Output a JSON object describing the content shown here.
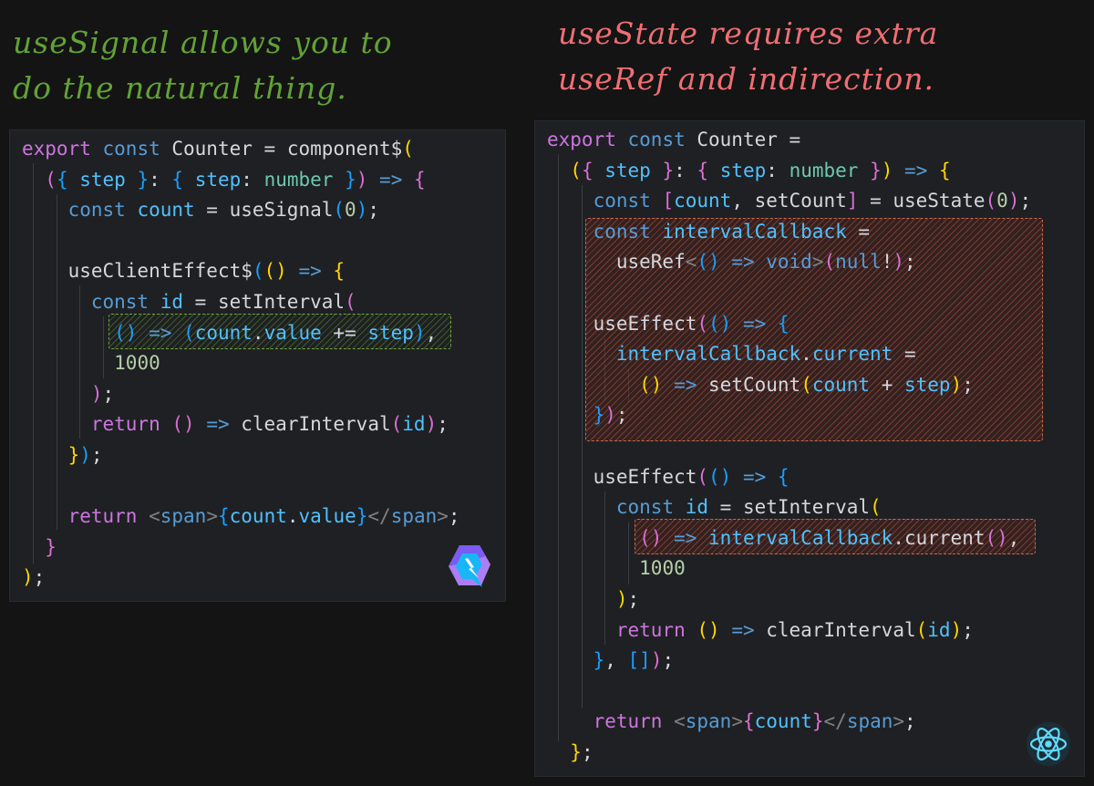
{
  "captions": {
    "left": "useSignal allows you to do the natural thing.",
    "right": "useState requires extra useRef and indirection."
  },
  "colors": {
    "keyword": "#cd75e0",
    "keyword_blue": "#569cd6",
    "identifier": "#d6d6dd",
    "variable": "#4fc1ff",
    "type": "#6dc8b0",
    "number": "#b5cea8",
    "operator": "#56b6c2",
    "bracket_yellow": "#ffd700",
    "bracket_pink": "#da70d6",
    "bracket_blue": "#179fff",
    "tag": "#808080",
    "caption_left": "#62a334",
    "caption_right": "#ef6e73",
    "background": "#141414",
    "panel": "#1f2023"
  },
  "logos": {
    "left": "qwik-logo",
    "right": "react-logo"
  },
  "left_panel": {
    "lines": [
      [
        {
          "t": "export ",
          "c": "keyword"
        },
        {
          "t": "const ",
          "c": "keyword_blue"
        },
        {
          "t": "Counter",
          "c": "identifier"
        },
        {
          "t": " = ",
          "c": "identifier"
        },
        {
          "t": "component$",
          "c": "identifier"
        },
        {
          "t": "(",
          "c": "bracket_yellow"
        }
      ],
      [
        {
          "t": "  ",
          "c": "identifier"
        },
        {
          "t": "(",
          "c": "bracket_pink"
        },
        {
          "t": "{",
          "c": "bracket_blue"
        },
        {
          "t": " step ",
          "c": "variable"
        },
        {
          "t": "}",
          "c": "bracket_blue"
        },
        {
          "t": ": ",
          "c": "identifier"
        },
        {
          "t": "{",
          "c": "bracket_blue"
        },
        {
          "t": " step",
          "c": "variable"
        },
        {
          "t": ": ",
          "c": "identifier"
        },
        {
          "t": "number",
          "c": "type"
        },
        {
          "t": " }",
          "c": "bracket_blue"
        },
        {
          "t": ")",
          "c": "bracket_pink"
        },
        {
          "t": " => ",
          "c": "keyword_blue"
        },
        {
          "t": "{",
          "c": "bracket_pink"
        }
      ],
      [
        {
          "t": "    ",
          "c": "identifier"
        },
        {
          "t": "const ",
          "c": "keyword_blue"
        },
        {
          "t": "count",
          "c": "variable"
        },
        {
          "t": " = ",
          "c": "identifier"
        },
        {
          "t": "useSignal",
          "c": "identifier"
        },
        {
          "t": "(",
          "c": "bracket_blue"
        },
        {
          "t": "0",
          "c": "number"
        },
        {
          "t": ")",
          "c": "bracket_blue"
        },
        {
          "t": ";",
          "c": "identifier"
        }
      ],
      [],
      [
        {
          "t": "    ",
          "c": "identifier"
        },
        {
          "t": "useClientEffect$",
          "c": "identifier"
        },
        {
          "t": "(",
          "c": "bracket_blue"
        },
        {
          "t": "()",
          "c": "bracket_yellow"
        },
        {
          "t": " => ",
          "c": "keyword_blue"
        },
        {
          "t": "{",
          "c": "bracket_yellow"
        }
      ],
      [
        {
          "t": "      ",
          "c": "identifier"
        },
        {
          "t": "const ",
          "c": "keyword_blue"
        },
        {
          "t": "id",
          "c": "variable"
        },
        {
          "t": " = ",
          "c": "identifier"
        },
        {
          "t": "setInterval",
          "c": "identifier"
        },
        {
          "t": "(",
          "c": "bracket_pink"
        }
      ],
      [
        {
          "t": "        ",
          "c": "identifier"
        },
        {
          "t": "()",
          "c": "bracket_blue"
        },
        {
          "t": " => ",
          "c": "keyword_blue"
        },
        {
          "t": "(",
          "c": "bracket_blue"
        },
        {
          "t": "count",
          "c": "variable"
        },
        {
          "t": ".",
          "c": "identifier"
        },
        {
          "t": "value",
          "c": "variable"
        },
        {
          "t": " += ",
          "c": "identifier"
        },
        {
          "t": "step",
          "c": "variable"
        },
        {
          "t": ")",
          "c": "bracket_blue"
        },
        {
          "t": ",",
          "c": "identifier"
        }
      ],
      [
        {
          "t": "        ",
          "c": "identifier"
        },
        {
          "t": "1000",
          "c": "number"
        }
      ],
      [
        {
          "t": "      ",
          "c": "identifier"
        },
        {
          "t": ")",
          "c": "bracket_pink"
        },
        {
          "t": ";",
          "c": "identifier"
        }
      ],
      [
        {
          "t": "      ",
          "c": "identifier"
        },
        {
          "t": "return ",
          "c": "keyword"
        },
        {
          "t": "()",
          "c": "bracket_pink"
        },
        {
          "t": " => ",
          "c": "keyword_blue"
        },
        {
          "t": "clearInterval",
          "c": "identifier"
        },
        {
          "t": "(",
          "c": "bracket_pink"
        },
        {
          "t": "id",
          "c": "variable"
        },
        {
          "t": ")",
          "c": "bracket_pink"
        },
        {
          "t": ";",
          "c": "identifier"
        }
      ],
      [
        {
          "t": "    ",
          "c": "identifier"
        },
        {
          "t": "}",
          "c": "bracket_yellow"
        },
        {
          "t": ")",
          "c": "bracket_blue"
        },
        {
          "t": ";",
          "c": "identifier"
        }
      ],
      [],
      [
        {
          "t": "    ",
          "c": "identifier"
        },
        {
          "t": "return ",
          "c": "keyword"
        },
        {
          "t": "<",
          "c": "tag"
        },
        {
          "t": "span",
          "c": "keyword_blue"
        },
        {
          "t": ">",
          "c": "tag"
        },
        {
          "t": "{",
          "c": "bracket_blue"
        },
        {
          "t": "count",
          "c": "variable"
        },
        {
          "t": ".",
          "c": "identifier"
        },
        {
          "t": "value",
          "c": "variable"
        },
        {
          "t": "}",
          "c": "bracket_blue"
        },
        {
          "t": "</",
          "c": "tag"
        },
        {
          "t": "span",
          "c": "keyword_blue"
        },
        {
          "t": ">",
          "c": "tag"
        },
        {
          "t": ";",
          "c": "identifier"
        }
      ],
      [
        {
          "t": "  ",
          "c": "identifier"
        },
        {
          "t": "}",
          "c": "bracket_pink"
        }
      ],
      [
        {
          "t": ")",
          "c": "bracket_yellow"
        },
        {
          "t": ";",
          "c": "identifier"
        }
      ]
    ]
  },
  "right_panel": {
    "lines": [
      [
        {
          "t": "export ",
          "c": "keyword"
        },
        {
          "t": "const ",
          "c": "keyword_blue"
        },
        {
          "t": "Counter",
          "c": "identifier"
        },
        {
          "t": " =",
          "c": "identifier"
        }
      ],
      [
        {
          "t": "  ",
          "c": "identifier"
        },
        {
          "t": "(",
          "c": "bracket_yellow"
        },
        {
          "t": "{",
          "c": "bracket_pink"
        },
        {
          "t": " step ",
          "c": "variable"
        },
        {
          "t": "}",
          "c": "bracket_pink"
        },
        {
          "t": ": ",
          "c": "identifier"
        },
        {
          "t": "{",
          "c": "bracket_pink"
        },
        {
          "t": " step",
          "c": "variable"
        },
        {
          "t": ": ",
          "c": "identifier"
        },
        {
          "t": "number",
          "c": "type"
        },
        {
          "t": " }",
          "c": "bracket_pink"
        },
        {
          "t": ")",
          "c": "bracket_yellow"
        },
        {
          "t": " => ",
          "c": "keyword_blue"
        },
        {
          "t": "{",
          "c": "bracket_yellow"
        }
      ],
      [
        {
          "t": "    ",
          "c": "identifier"
        },
        {
          "t": "const ",
          "c": "keyword_blue"
        },
        {
          "t": "[",
          "c": "bracket_pink"
        },
        {
          "t": "count",
          "c": "variable"
        },
        {
          "t": ", ",
          "c": "identifier"
        },
        {
          "t": "setCount",
          "c": "identifier"
        },
        {
          "t": "]",
          "c": "bracket_pink"
        },
        {
          "t": " = ",
          "c": "identifier"
        },
        {
          "t": "useState",
          "c": "identifier"
        },
        {
          "t": "(",
          "c": "bracket_pink"
        },
        {
          "t": "0",
          "c": "number"
        },
        {
          "t": ")",
          "c": "bracket_pink"
        },
        {
          "t": ";",
          "c": "identifier"
        }
      ],
      [
        {
          "t": "    ",
          "c": "identifier"
        },
        {
          "t": "const ",
          "c": "keyword_blue"
        },
        {
          "t": "intervalCallback",
          "c": "variable"
        },
        {
          "t": " =",
          "c": "identifier"
        }
      ],
      [
        {
          "t": "      ",
          "c": "identifier"
        },
        {
          "t": "useRef",
          "c": "identifier"
        },
        {
          "t": "<",
          "c": "tag"
        },
        {
          "t": "()",
          "c": "bracket_blue"
        },
        {
          "t": " => ",
          "c": "keyword_blue"
        },
        {
          "t": "void",
          "c": "keyword_blue"
        },
        {
          "t": ">",
          "c": "tag"
        },
        {
          "t": "(",
          "c": "bracket_pink"
        },
        {
          "t": "null",
          "c": "keyword_blue"
        },
        {
          "t": "!",
          "c": "identifier"
        },
        {
          "t": ")",
          "c": "bracket_pink"
        },
        {
          "t": ";",
          "c": "identifier"
        }
      ],
      [],
      [
        {
          "t": "    ",
          "c": "identifier"
        },
        {
          "t": "useEffect",
          "c": "identifier"
        },
        {
          "t": "(",
          "c": "bracket_pink"
        },
        {
          "t": "()",
          "c": "bracket_blue"
        },
        {
          "t": " => ",
          "c": "keyword_blue"
        },
        {
          "t": "{",
          "c": "bracket_blue"
        }
      ],
      [
        {
          "t": "      ",
          "c": "identifier"
        },
        {
          "t": "intervalCallback",
          "c": "variable"
        },
        {
          "t": ".",
          "c": "identifier"
        },
        {
          "t": "current",
          "c": "variable"
        },
        {
          "t": " =",
          "c": "identifier"
        }
      ],
      [
        {
          "t": "        ",
          "c": "identifier"
        },
        {
          "t": "()",
          "c": "bracket_yellow"
        },
        {
          "t": " => ",
          "c": "keyword_blue"
        },
        {
          "t": "setCount",
          "c": "identifier"
        },
        {
          "t": "(",
          "c": "bracket_yellow"
        },
        {
          "t": "count",
          "c": "variable"
        },
        {
          "t": " + ",
          "c": "identifier"
        },
        {
          "t": "step",
          "c": "variable"
        },
        {
          "t": ")",
          "c": "bracket_yellow"
        },
        {
          "t": ";",
          "c": "identifier"
        }
      ],
      [
        {
          "t": "    ",
          "c": "identifier"
        },
        {
          "t": "}",
          "c": "bracket_blue"
        },
        {
          "t": ")",
          "c": "bracket_pink"
        },
        {
          "t": ";",
          "c": "identifier"
        }
      ],
      [],
      [
        {
          "t": "    ",
          "c": "identifier"
        },
        {
          "t": "useEffect",
          "c": "identifier"
        },
        {
          "t": "(",
          "c": "bracket_pink"
        },
        {
          "t": "()",
          "c": "bracket_blue"
        },
        {
          "t": " => ",
          "c": "keyword_blue"
        },
        {
          "t": "{",
          "c": "bracket_blue"
        }
      ],
      [
        {
          "t": "      ",
          "c": "identifier"
        },
        {
          "t": "const ",
          "c": "keyword_blue"
        },
        {
          "t": "id",
          "c": "variable"
        },
        {
          "t": " = ",
          "c": "identifier"
        },
        {
          "t": "setInterval",
          "c": "identifier"
        },
        {
          "t": "(",
          "c": "bracket_yellow"
        }
      ],
      [
        {
          "t": "        ",
          "c": "identifier"
        },
        {
          "t": "()",
          "c": "bracket_pink"
        },
        {
          "t": " => ",
          "c": "keyword_blue"
        },
        {
          "t": "intervalCallback",
          "c": "variable"
        },
        {
          "t": ".",
          "c": "identifier"
        },
        {
          "t": "current",
          "c": "identifier"
        },
        {
          "t": "()",
          "c": "bracket_pink"
        },
        {
          "t": ",",
          "c": "identifier"
        }
      ],
      [
        {
          "t": "        ",
          "c": "identifier"
        },
        {
          "t": "1000",
          "c": "number"
        }
      ],
      [
        {
          "t": "      ",
          "c": "identifier"
        },
        {
          "t": ")",
          "c": "bracket_yellow"
        },
        {
          "t": ";",
          "c": "identifier"
        }
      ],
      [
        {
          "t": "      ",
          "c": "identifier"
        },
        {
          "t": "return ",
          "c": "keyword"
        },
        {
          "t": "()",
          "c": "bracket_yellow"
        },
        {
          "t": " => ",
          "c": "keyword_blue"
        },
        {
          "t": "clearInterval",
          "c": "identifier"
        },
        {
          "t": "(",
          "c": "bracket_yellow"
        },
        {
          "t": "id",
          "c": "variable"
        },
        {
          "t": ")",
          "c": "bracket_yellow"
        },
        {
          "t": ";",
          "c": "identifier"
        }
      ],
      [
        {
          "t": "    ",
          "c": "identifier"
        },
        {
          "t": "}",
          "c": "bracket_blue"
        },
        {
          "t": ", ",
          "c": "identifier"
        },
        {
          "t": "[]",
          "c": "bracket_blue"
        },
        {
          "t": ")",
          "c": "bracket_pink"
        },
        {
          "t": ";",
          "c": "identifier"
        }
      ],
      [],
      [
        {
          "t": "    ",
          "c": "identifier"
        },
        {
          "t": "return ",
          "c": "keyword"
        },
        {
          "t": "<",
          "c": "tag"
        },
        {
          "t": "span",
          "c": "keyword_blue"
        },
        {
          "t": ">",
          "c": "tag"
        },
        {
          "t": "{",
          "c": "bracket_pink"
        },
        {
          "t": "count",
          "c": "variable"
        },
        {
          "t": "}",
          "c": "bracket_pink"
        },
        {
          "t": "</",
          "c": "tag"
        },
        {
          "t": "span",
          "c": "keyword_blue"
        },
        {
          "t": ">",
          "c": "tag"
        },
        {
          "t": ";",
          "c": "identifier"
        }
      ],
      [
        {
          "t": "  ",
          "c": "identifier"
        },
        {
          "t": "}",
          "c": "bracket_yellow"
        },
        {
          "t": ";",
          "c": "identifier"
        }
      ]
    ]
  }
}
